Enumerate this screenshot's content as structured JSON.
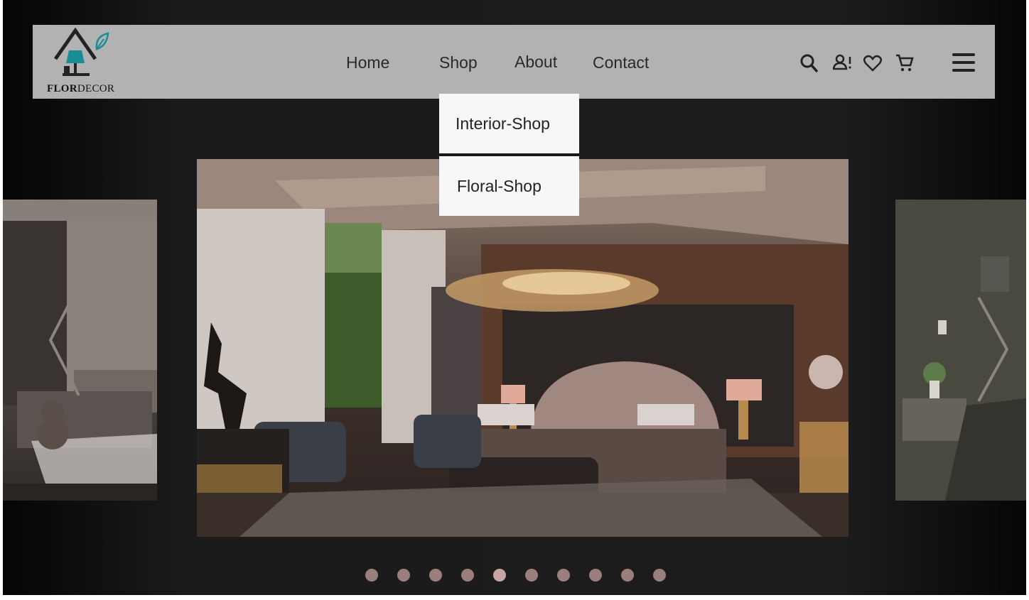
{
  "brand": {
    "logo_flor": "FLOR",
    "logo_decor": "DECOR"
  },
  "nav": {
    "links": [
      {
        "label": "Home"
      },
      {
        "label": "Shop"
      },
      {
        "label": "About"
      },
      {
        "label": "Contact"
      }
    ],
    "icons": [
      "search-icon",
      "account-icon",
      "heart-icon",
      "cart-icon",
      "hamburger-menu-icon"
    ]
  },
  "shop_dropdown": {
    "items": [
      {
        "label": "Interior-Shop"
      },
      {
        "label": "Floral-Shop"
      }
    ]
  },
  "carousel": {
    "slides": [
      {
        "name": "side-left-bedroom"
      },
      {
        "name": "main-luxury-bedroom"
      },
      {
        "name": "side-right-bedroom"
      }
    ],
    "dots_count": 10,
    "active_dot_index": 4
  },
  "colors": {
    "navbar_bg": "#b2b2b2",
    "page_bg": "#1c1c1c",
    "dropdown_bg": "#f7f7f7",
    "logo_accent": "#1a8c96",
    "dot": "#9b7f7c",
    "dot_active": "#c8a5a1"
  }
}
